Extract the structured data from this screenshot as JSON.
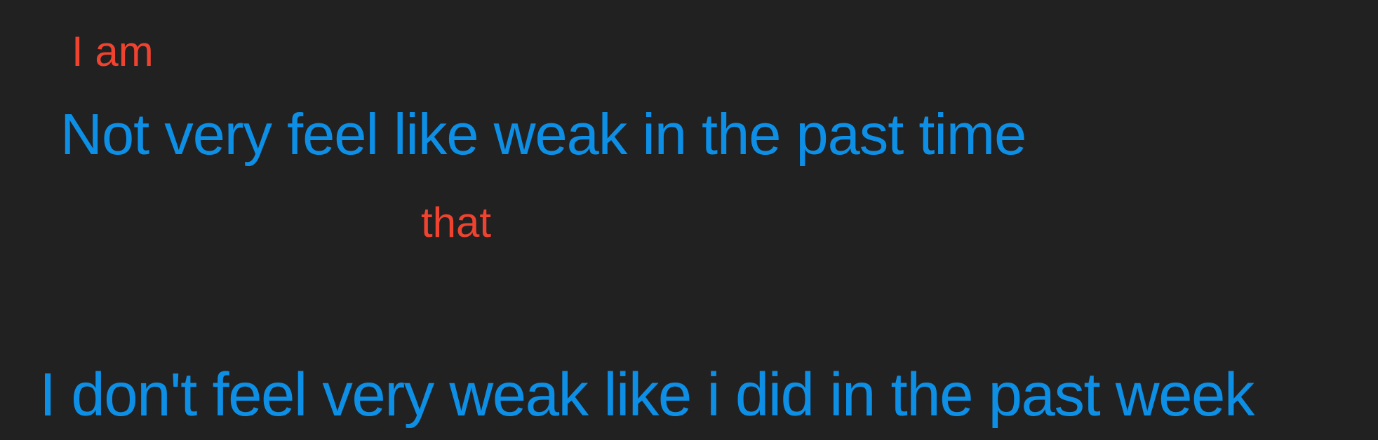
{
  "colors": {
    "background": "#212121",
    "insertion": "#ef4330",
    "sentence": "#0d8fe6"
  },
  "annotations": {
    "insert_1": "I am",
    "insert_2": "that"
  },
  "sentences": {
    "original": "Not very feel like weak in the past time",
    "corrected": "I don't feel very weak like i did in the past week"
  }
}
